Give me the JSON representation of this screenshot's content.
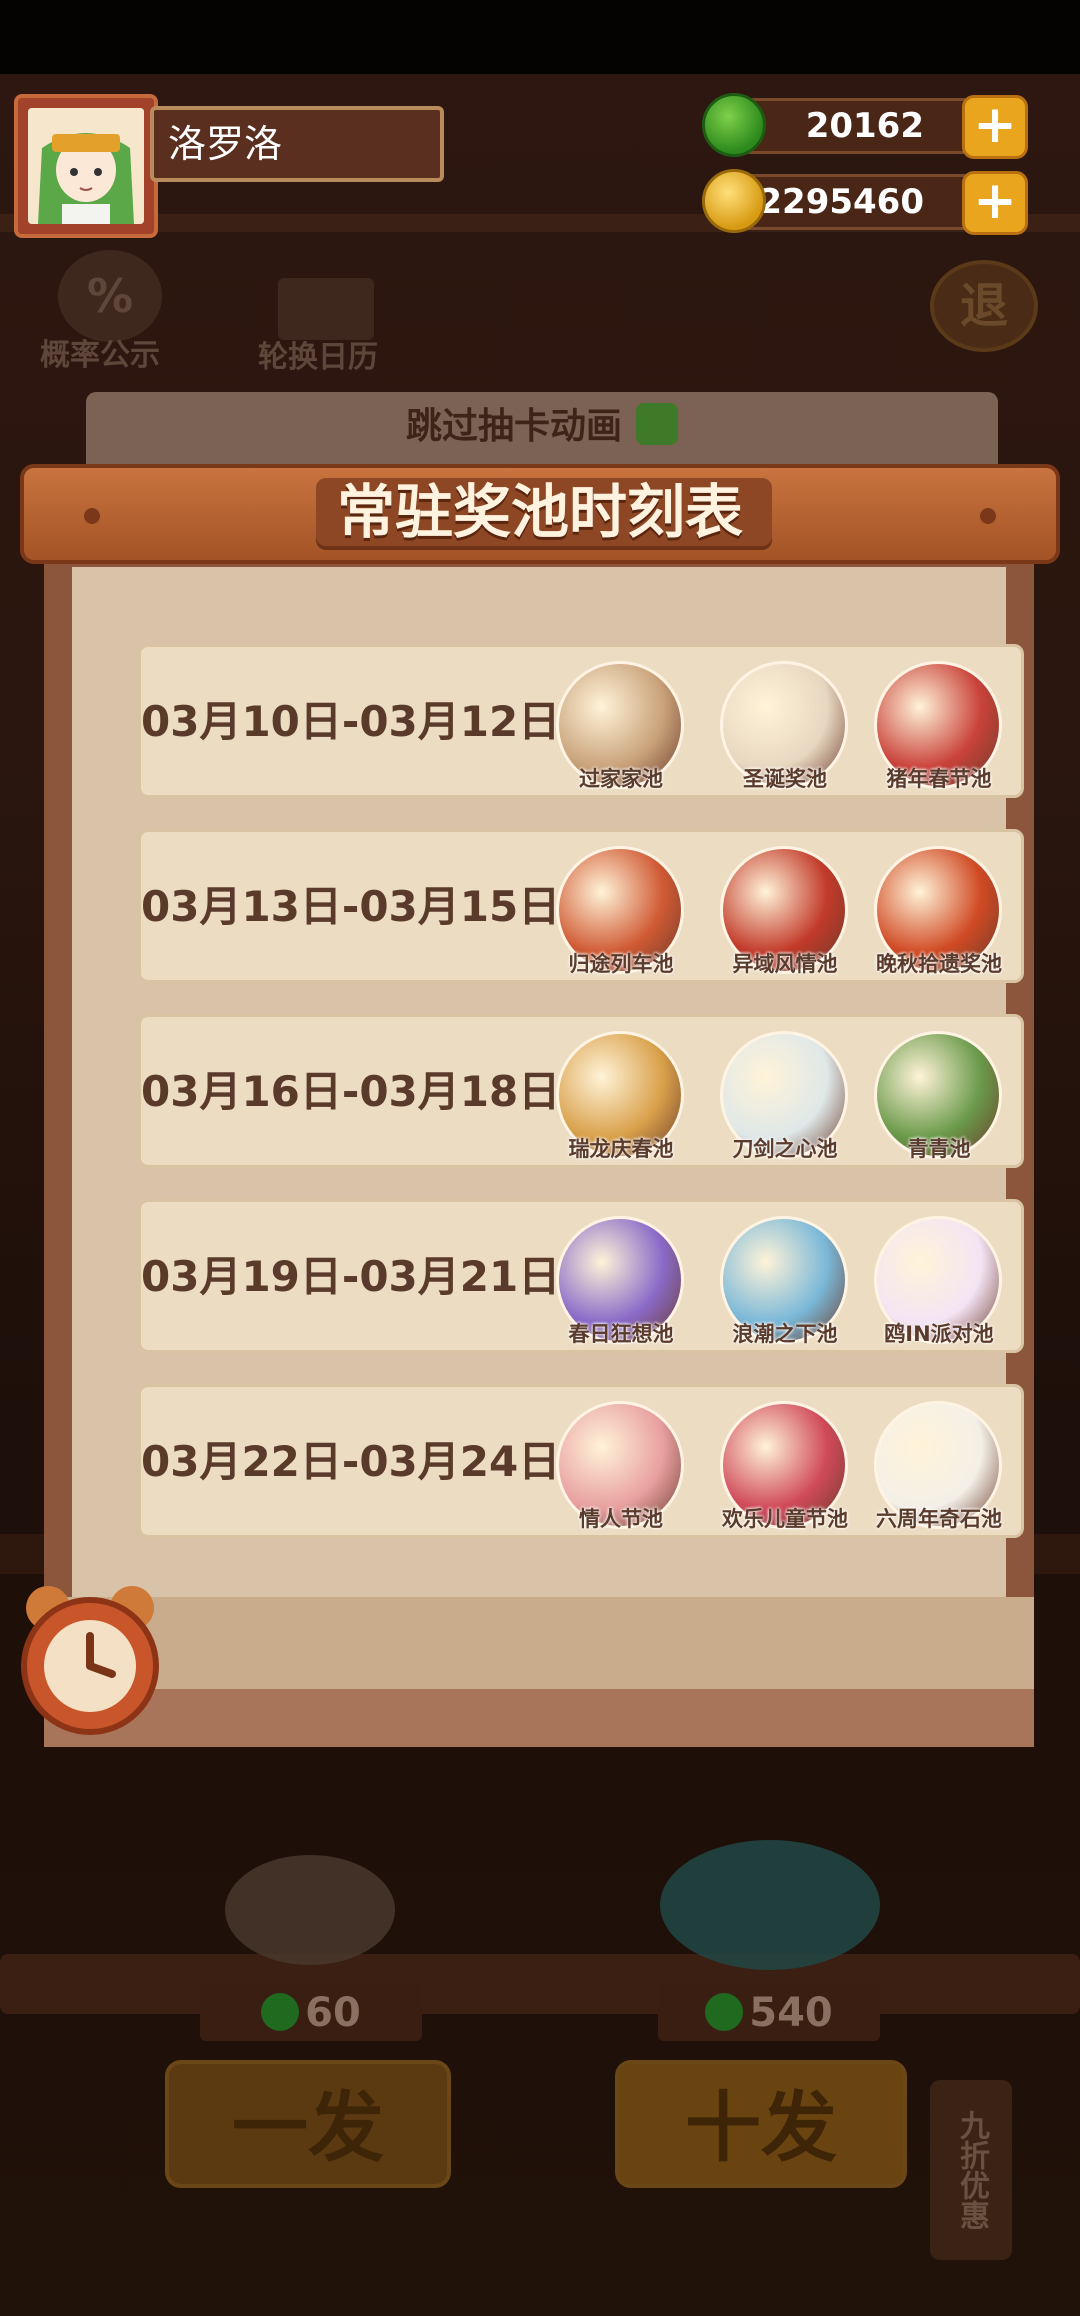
{
  "player": {
    "name": "洛罗洛"
  },
  "resources": {
    "jade": {
      "value": "20162",
      "icon": "green-jade-coin-icon"
    },
    "gold": {
      "value": "2295460",
      "icon": "gold-coin-icon"
    }
  },
  "background_menu": {
    "probability_label": "概率公示",
    "rotation_label": "轮换日历",
    "exit_label": "退",
    "skip_animation_label": "跳过抽卡动画"
  },
  "panel": {
    "title": "常驻奖池时刻表",
    "rows": [
      {
        "date": "03月10日-03月12日",
        "pools": [
          "过家家池",
          "圣诞奖池",
          "猪年春节池"
        ]
      },
      {
        "date": "03月13日-03月15日",
        "pools": [
          "归途列车池",
          "异域风情池",
          "晚秋拾遗奖池"
        ]
      },
      {
        "date": "03月16日-03月18日",
        "pools": [
          "瑞龙庆春池",
          "刀剑之心池",
          "青青池"
        ]
      },
      {
        "date": "03月19日-03月21日",
        "pools": [
          "春日狂想池",
          "浪潮之下池",
          "鸥IN派对池"
        ]
      },
      {
        "date": "03月22日-03月24日",
        "pools": [
          "情人节池",
          "欢乐儿童节池",
          "六周年奇石池"
        ]
      }
    ]
  },
  "bottom": {
    "single_cost": "60",
    "ten_cost": "540",
    "single_label": "一发",
    "ten_label": "十发",
    "discount_label": "九折优惠"
  },
  "colors": {
    "panel_bg": "#d9c3a8",
    "banner": "#c9743f",
    "row_bg": "#ecdcc2",
    "text_brown": "#5a3a2a"
  }
}
